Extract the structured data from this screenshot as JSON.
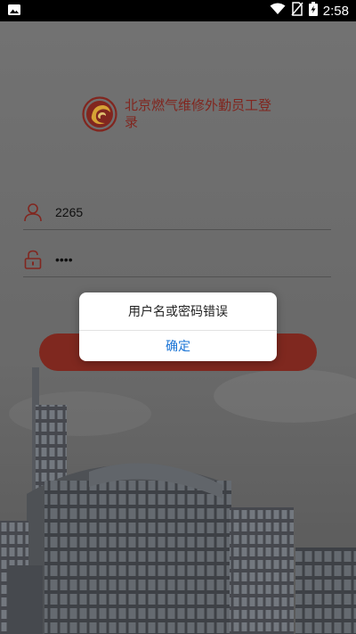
{
  "status_bar": {
    "time": "2:58",
    "icons": [
      "image-icon",
      "wifi-icon",
      "no-sim-icon",
      "battery-charging-icon"
    ]
  },
  "app": {
    "title": "北京燃气维修外勤员工登录",
    "brand_color": "#8c2a22"
  },
  "form": {
    "username": "2265",
    "password_masked": "••••",
    "login_button_color": "#8a2c22"
  },
  "dialog": {
    "message": "用户名或密码错误",
    "confirm_label": "确定",
    "confirm_color": "#1a74d6"
  }
}
